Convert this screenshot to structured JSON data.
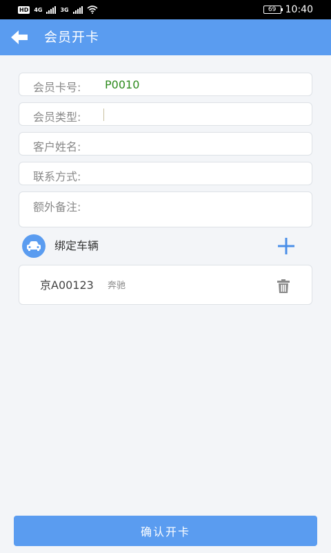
{
  "status_bar": {
    "network_hd": "HD",
    "sim1_type": "4G",
    "sim2_type": "3G",
    "battery": "69",
    "time": "10:40"
  },
  "header": {
    "title": "会员开卡",
    "back_icon": "arrow-left-icon"
  },
  "form": {
    "card_number": {
      "label": "会员卡号:",
      "value": "P0010",
      "value_color": "#2e8b1e"
    },
    "member_type": {
      "label": "会员类型:",
      "value": ""
    },
    "customer_name": {
      "label": "客户姓名:",
      "value": ""
    },
    "contact": {
      "label": "联系方式:",
      "value": ""
    },
    "remarks": {
      "label": "额外备注:",
      "value": ""
    }
  },
  "vehicles": {
    "section_label": "绑定车辆",
    "section_icon": "car-icon",
    "add_icon": "plus-icon",
    "items": [
      {
        "plate": "京A00123",
        "brand": "奔驰",
        "delete_icon": "trash-icon"
      }
    ]
  },
  "footer": {
    "confirm_label": "确认开卡"
  },
  "colors": {
    "accent": "#5a9cf0",
    "background": "#f3f5f8",
    "card_number_text": "#2e8b1e"
  }
}
